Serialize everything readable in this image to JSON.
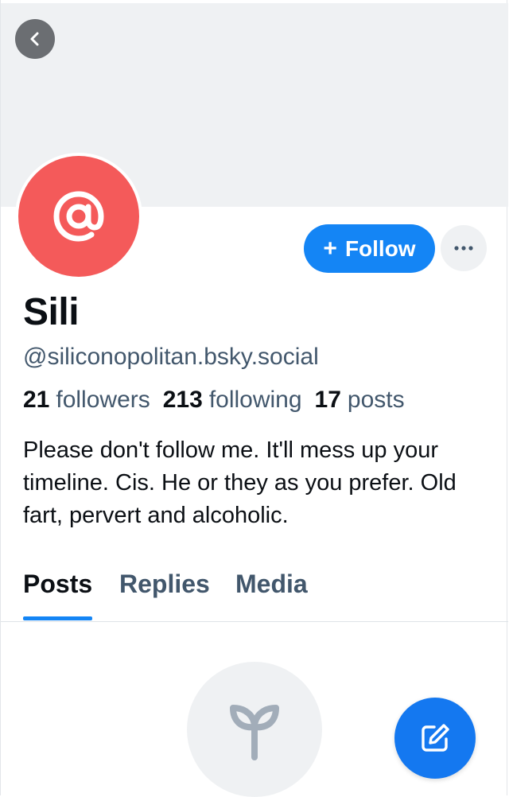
{
  "header": {
    "back_icon": "chevron-left-icon"
  },
  "profile": {
    "avatar_icon": "at-sign-icon",
    "display_name": "Sili",
    "handle": "@siliconopolitan.bsky.social",
    "follow_label": "Follow",
    "follow_plus": "+",
    "more_icon": "ellipsis-icon",
    "stats": {
      "followers_count": "21",
      "followers_label": "followers",
      "following_count": "213",
      "following_label": "following",
      "posts_count": "17",
      "posts_label": "posts"
    },
    "bio": "Please don't follow me. It'll mess up your timeline. Cis. He or they as you prefer. Old fart, pervert and alcoholic."
  },
  "tabs": [
    {
      "label": "Posts",
      "active": true
    },
    {
      "label": "Replies",
      "active": false
    },
    {
      "label": "Media",
      "active": false
    }
  ],
  "empty_state": {
    "icon": "seedling-icon"
  },
  "fab": {
    "icon": "compose-icon"
  },
  "colors": {
    "accent": "#1485f5",
    "avatar_bg": "#f45a5a",
    "muted_text": "#42576c",
    "banner_bg": "#eff1f3"
  }
}
